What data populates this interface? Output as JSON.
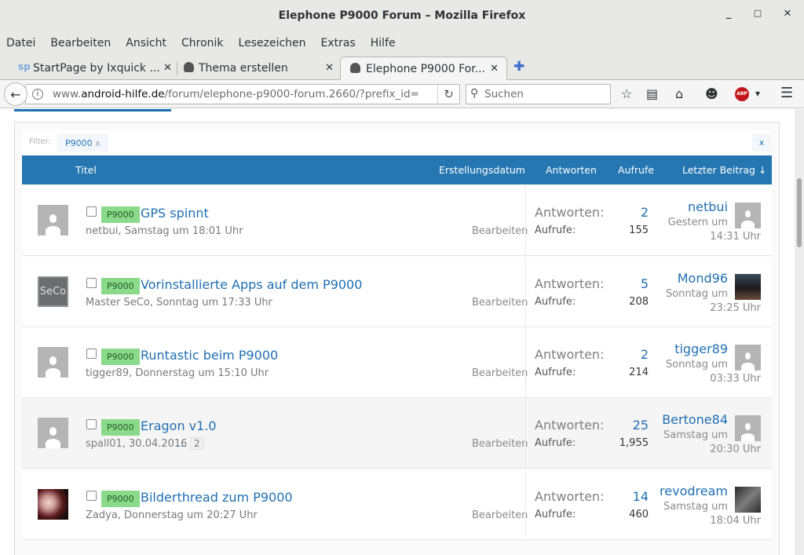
{
  "window": {
    "title": "Elephone P9000 Forum – Mozilla Firefox",
    "minimize": "_",
    "maximize": "□",
    "close": "✕"
  },
  "menu": [
    "Datei",
    "Bearbeiten",
    "Ansicht",
    "Chronik",
    "Lesezeichen",
    "Extras",
    "Hilfe"
  ],
  "tabs": [
    {
      "label": "StartPage by Ixquick ...",
      "icon": "sp"
    },
    {
      "label": "Thema erstellen",
      "icon": "android"
    },
    {
      "label": "Elephone P9000 For...",
      "icon": "android"
    }
  ],
  "nav": {
    "url_prefix": "www.",
    "url_domain": "android-hilfe.de",
    "url_path": "/forum/elephone-p9000-forum.2660/?prefix_id=",
    "search_placeholder": "Suchen"
  },
  "filter": {
    "label": "Filter:",
    "value": "P9000",
    "remove": "x",
    "clear": "x"
  },
  "columns": {
    "title": "Titel",
    "created": "Erstellungsdatum",
    "replies": "Antworten",
    "views": "Aufrufe",
    "last": "Letzter Beitrag ↓"
  },
  "labels": {
    "replies": "Antworten:",
    "views": "Aufrufe:",
    "edit": "Bearbeiten",
    "prefix": "P9000"
  },
  "threads": [
    {
      "title": "GPS spinnt",
      "meta": "netbui, Samstag um 18:01 Uhr",
      "replies": "2",
      "views": "155",
      "last_user": "netbui",
      "last_date1": "Gestern um",
      "last_date2": "14:31 Uhr"
    },
    {
      "title": "Vorinstallierte Apps auf dem P9000",
      "meta": "Master SeCo, Sonntag um 17:33 Uhr",
      "replies": "5",
      "views": "208",
      "last_user": "Mond96",
      "last_date1": "Sonntag um",
      "last_date2": "23:25 Uhr",
      "avatar_text": "SeCo"
    },
    {
      "title": "Runtastic beim P9000",
      "meta": "tigger89, Donnerstag um 15:10 Uhr",
      "replies": "2",
      "views": "214",
      "last_user": "tigger89",
      "last_date1": "Sonntag um",
      "last_date2": "03:33 Uhr"
    },
    {
      "title": "Eragon v1.0",
      "meta": "spall01, 30.04.2016",
      "page_dots": "…",
      "page_num": "2",
      "replies": "25",
      "views": "1,955",
      "last_user": "Bertone84",
      "last_date1": "Samstag um",
      "last_date2": "20:30 Uhr"
    },
    {
      "title": "Bilderthread zum P9000",
      "meta": "Zadya, Donnerstag um 20:27 Uhr",
      "replies": "14",
      "views": "460",
      "last_user": "revodream",
      "last_date1": "Samstag um",
      "last_date2": "18:04 Uhr"
    }
  ]
}
